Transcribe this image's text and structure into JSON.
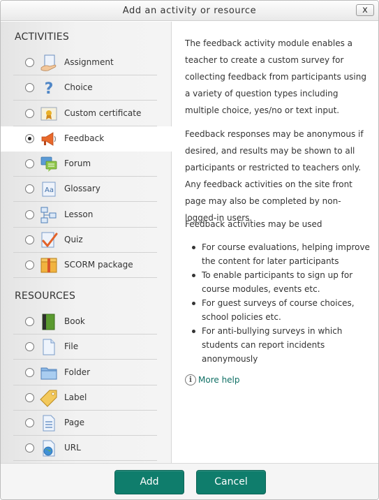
{
  "dialog": {
    "title": "Add an activity or resource",
    "close_label": "x"
  },
  "activities": {
    "heading": "ACTIVITIES",
    "items": [
      {
        "label": "Assignment",
        "icon": "assignment-icon",
        "selected": false
      },
      {
        "label": "Choice",
        "icon": "choice-icon",
        "selected": false
      },
      {
        "label": "Custom certificate",
        "icon": "certificate-icon",
        "selected": false
      },
      {
        "label": "Feedback",
        "icon": "feedback-icon",
        "selected": true
      },
      {
        "label": "Forum",
        "icon": "forum-icon",
        "selected": false
      },
      {
        "label": "Glossary",
        "icon": "glossary-icon",
        "selected": false
      },
      {
        "label": "Lesson",
        "icon": "lesson-icon",
        "selected": false
      },
      {
        "label": "Quiz",
        "icon": "quiz-icon",
        "selected": false
      },
      {
        "label": "SCORM package",
        "icon": "scorm-icon",
        "selected": false
      }
    ]
  },
  "resources": {
    "heading": "RESOURCES",
    "items": [
      {
        "label": "Book",
        "icon": "book-icon",
        "selected": false
      },
      {
        "label": "File",
        "icon": "file-icon",
        "selected": false
      },
      {
        "label": "Folder",
        "icon": "folder-icon",
        "selected": false
      },
      {
        "label": "Label",
        "icon": "label-icon",
        "selected": false
      },
      {
        "label": "Page",
        "icon": "page-icon",
        "selected": false
      },
      {
        "label": "URL",
        "icon": "url-icon",
        "selected": false
      }
    ]
  },
  "description": {
    "paragraphs": [
      "The feedback activity module enables a teacher to create a custom survey for collecting feedback from participants using a variety of question types including multiple choice, yes/no or text input.",
      "Feedback responses may be anonymous if desired, and results may be shown to all participants or restricted to teachers only. Any feedback activities on the site front page may also be completed by non-logged-in users.",
      "Feedback activities may be used"
    ],
    "bullets": [
      "For course evaluations, helping improve the content for later participants",
      "To enable participants to sign up for course modules, events etc.",
      "For guest surveys of course choices, school policies etc.",
      "For anti-bullying surveys in which students can report incidents anonymously"
    ],
    "more_help": "More help",
    "help_icon_glyph": "i"
  },
  "footer": {
    "add_label": "Add",
    "cancel_label": "Cancel"
  },
  "colors": {
    "accent": "#0f7d6c",
    "link": "#0f6f64"
  }
}
